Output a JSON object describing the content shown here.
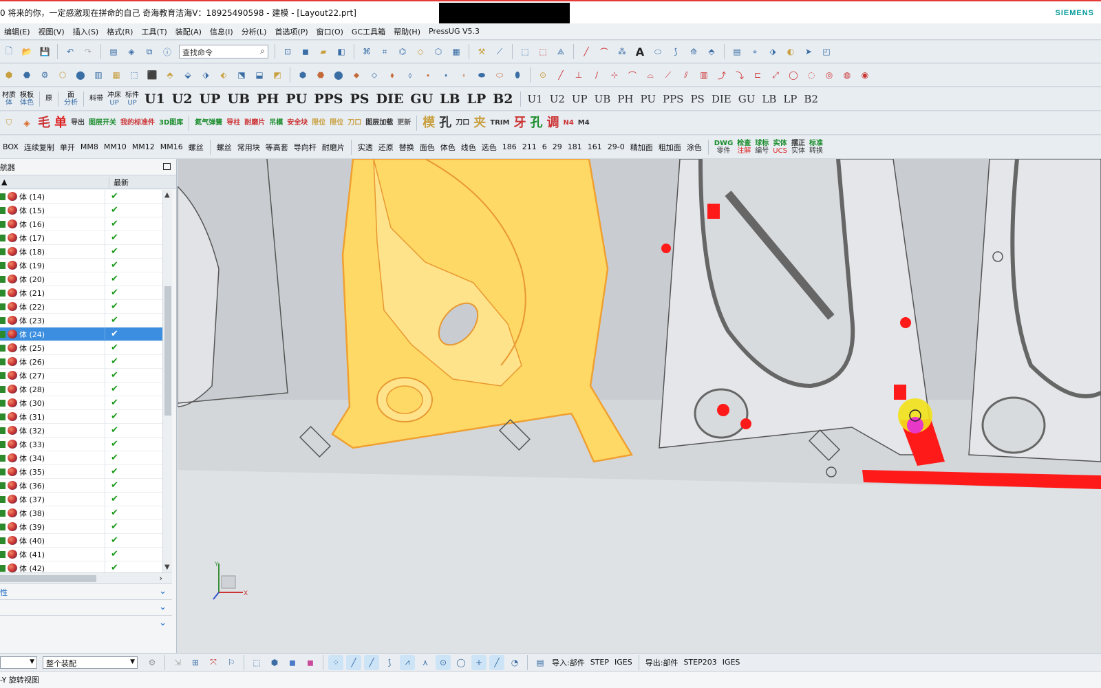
{
  "titlebar": {
    "title": "0 将来的你，一定感激现在拼命的自己 奇海教育洁海V：18925490598 - 建模 - [Layout22.prt]",
    "brand": "SIEMENS"
  },
  "menu": [
    "编辑(E)",
    "视图(V)",
    "插入(S)",
    "格式(R)",
    "工具(T)",
    "装配(A)",
    "信息(I)",
    "分析(L)",
    "首选项(P)",
    "窗口(O)",
    "GC工具箱",
    "帮助(H)",
    "PressUG V5.3"
  ],
  "toolbar": {
    "search_placeholder": "查找命令",
    "row3_left": [
      {
        "top": "材质",
        "bottom": "体"
      },
      {
        "top": "模板",
        "bottom": "体色"
      },
      {
        "top": "原",
        "bottom": ""
      },
      {
        "top": "面",
        "bottom": "分析"
      },
      {
        "top": "料带",
        "bottom": ""
      },
      {
        "top": "冲床",
        "bottom": "UP"
      },
      {
        "top": "标件",
        "bottom": "UP"
      }
    ],
    "row3_big": [
      "U1",
      "U2",
      "UP",
      "UB",
      "PH",
      "PU",
      "PPS",
      "PS",
      "DIE",
      "GU",
      "LB",
      "LP",
      "B2"
    ],
    "row3_small": [
      "U1",
      "U2",
      "UP",
      "UB",
      "PH",
      "PU",
      "PPS",
      "PS",
      "DIE",
      "GU",
      "LB",
      "LP",
      "B2"
    ],
    "row4": [
      "毛",
      "单",
      "导出",
      "图层开关",
      "我的标准件",
      "3D图库",
      "氮气弹簧",
      "导柱",
      "耐磨片",
      "吊模",
      "安全块",
      "限位",
      "限位",
      "刀口",
      "图层加载",
      "更新",
      "模",
      "孔",
      "刀口",
      "夹",
      "TRIM",
      "牙",
      "孔",
      "调",
      "N4",
      "M4"
    ],
    "row5_left": [
      "BOX",
      "连续复制",
      "单开",
      "MM8",
      "MM10",
      "MM12",
      "MM16",
      "螺丝"
    ],
    "row5_mid": [
      "螺丝",
      "常用块",
      "等高套",
      "导向杆",
      "耐磨片"
    ],
    "row5_right": [
      "实透",
      "还原",
      "替换",
      "面色",
      "体色",
      "线色",
      "选色",
      "186",
      "211",
      "6",
      "29",
      "181",
      "161",
      "29-0",
      "精加面",
      "粗加面",
      "涂色"
    ],
    "row5_tools": [
      {
        "top": "DWG",
        "bottom": "零件"
      },
      {
        "top": "检查",
        "bottom": "注解"
      },
      {
        "top": "球标",
        "bottom": "编号"
      },
      {
        "top": "实体",
        "bottom": "UCS"
      },
      {
        "top": "摆正",
        "bottom": "实体"
      },
      {
        "top": "标准",
        "bottom": "转换"
      }
    ]
  },
  "navigator": {
    "title": "航器",
    "col_name": "",
    "col_status": "最新",
    "rows": [
      {
        "name": "体 (14)",
        "status": "✔"
      },
      {
        "name": "体 (15)",
        "status": "✔"
      },
      {
        "name": "体 (16)",
        "status": "✔"
      },
      {
        "name": "体 (17)",
        "status": "✔"
      },
      {
        "name": "体 (18)",
        "status": "✔"
      },
      {
        "name": "体 (19)",
        "status": "✔"
      },
      {
        "name": "体 (20)",
        "status": "✔"
      },
      {
        "name": "体 (21)",
        "status": "✔"
      },
      {
        "name": "体 (22)",
        "status": "✔"
      },
      {
        "name": "体 (23)",
        "status": "✔"
      },
      {
        "name": "体 (24)",
        "status": "✔",
        "selected": true
      },
      {
        "name": "体 (25)",
        "status": "✔"
      },
      {
        "name": "体 (26)",
        "status": "✔"
      },
      {
        "name": "体 (27)",
        "status": "✔"
      },
      {
        "name": "体 (28)",
        "status": "✔"
      },
      {
        "name": "体 (30)",
        "status": "✔"
      },
      {
        "name": "体 (31)",
        "status": "✔"
      },
      {
        "name": "体 (32)",
        "status": "✔"
      },
      {
        "name": "体 (33)",
        "status": "✔"
      },
      {
        "name": "体 (34)",
        "status": "✔"
      },
      {
        "name": "体 (35)",
        "status": "✔"
      },
      {
        "name": "体 (36)",
        "status": "✔"
      },
      {
        "name": "体 (37)",
        "status": "✔"
      },
      {
        "name": "体 (38)",
        "status": "✔"
      },
      {
        "name": "体 (39)",
        "status": "✔"
      },
      {
        "name": "体 (40)",
        "status": "✔"
      },
      {
        "name": "体 (41)",
        "status": "✔"
      },
      {
        "name": "体 (42)",
        "status": "✔"
      }
    ],
    "sections": [
      "性",
      "",
      ""
    ]
  },
  "statusbar": {
    "filter_value": "",
    "assembly_value": "整个装配",
    "import_label": "导入:部件",
    "import_step": "STEP",
    "import_iges": "IGES",
    "export_label": "导出:部件",
    "export_step": "STEP203",
    "export_iges": "IGES"
  },
  "bottom": {
    "prompt": "-Y 旋转视图"
  },
  "axis": {
    "x": "X",
    "y": "Y"
  },
  "colors": {
    "selection": "#3b8ee0",
    "highlight_part": "#ffd966",
    "part_edge": "#f0a030",
    "feature_red": "#ff1a1a",
    "viewport_bg": "#dfe2e5"
  }
}
